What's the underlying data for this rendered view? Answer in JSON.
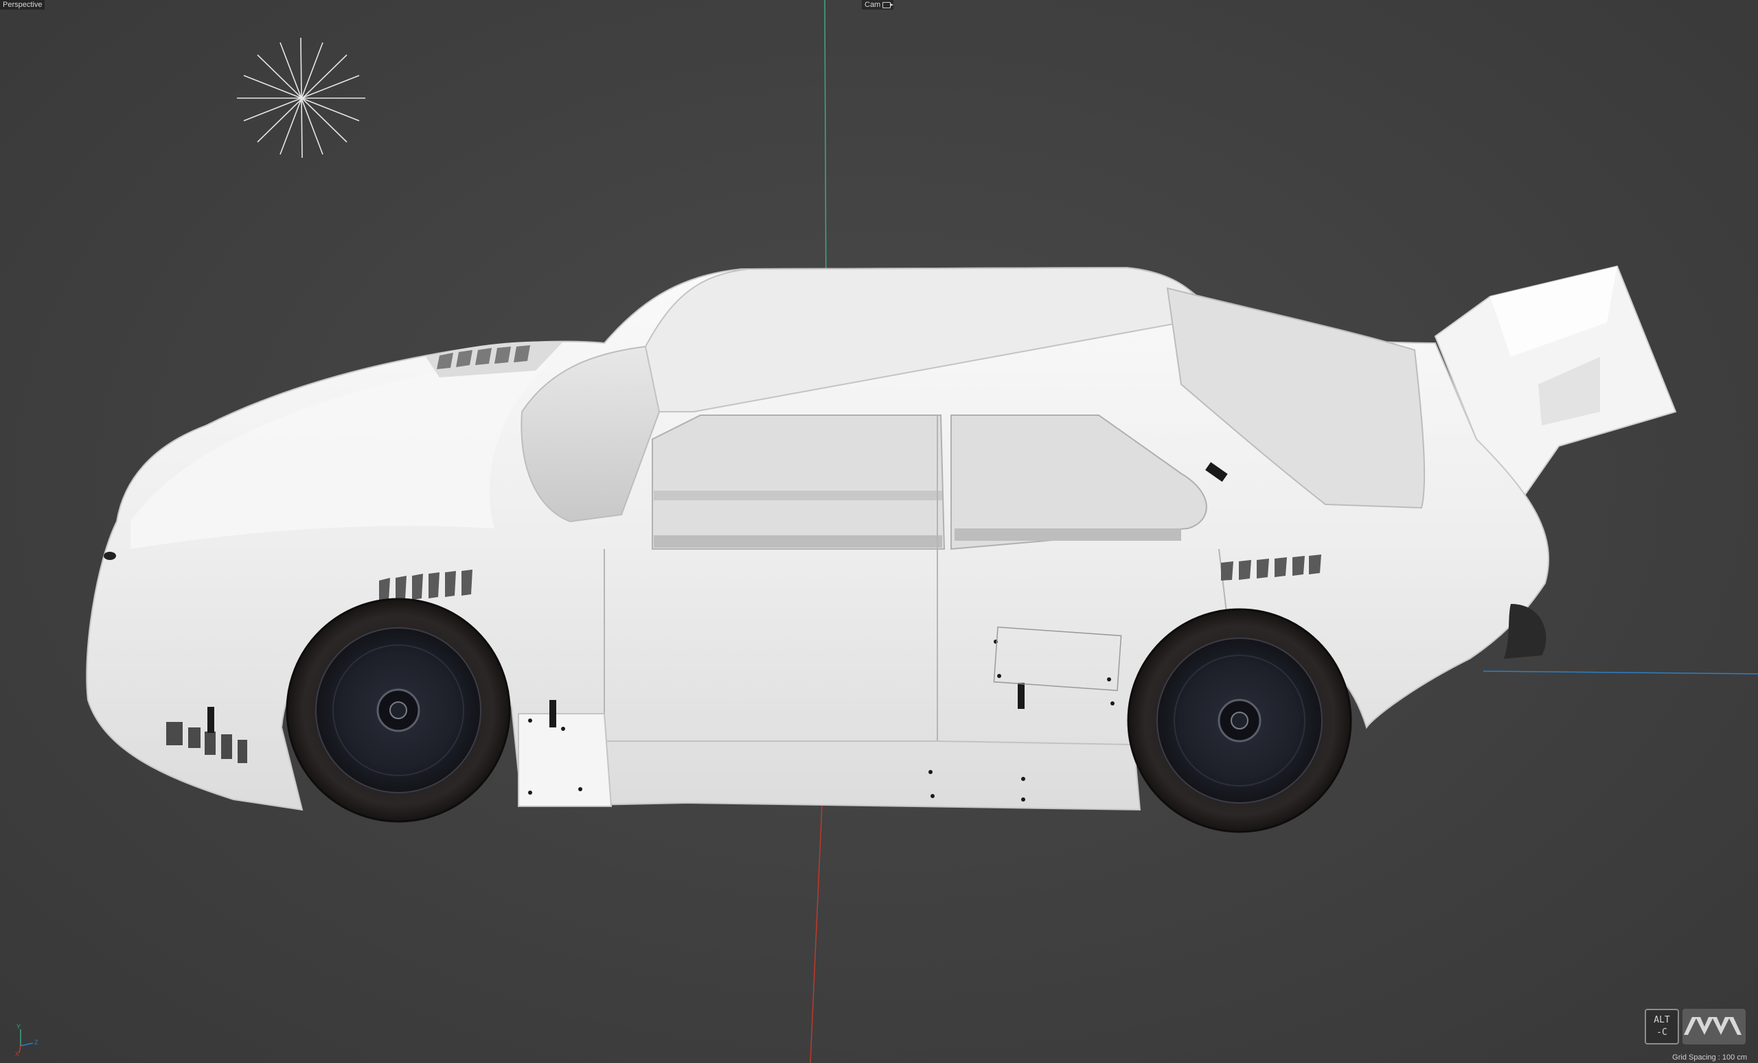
{
  "viewport": {
    "view_name": "Perspective",
    "camera_name": "Cam",
    "camera_icon": "camera-icon",
    "grid_spacing": "Grid Spacing : 100 cm",
    "axis_gizmo": {
      "y_label": "Y",
      "z_label": "Z",
      "x_label": "X"
    },
    "hud_badge": {
      "line1": "ALT",
      "line2": "-C"
    },
    "logo_icon": "maxon-logo-icon",
    "light_icon": "light-star-icon",
    "colors": {
      "background": "#404040",
      "y_axis": "#3fa58a",
      "x_axis": "#c0392b",
      "z_axis": "#2f7fc1",
      "car_body": "#f2f2f2",
      "tire": "#1b1818"
    }
  }
}
